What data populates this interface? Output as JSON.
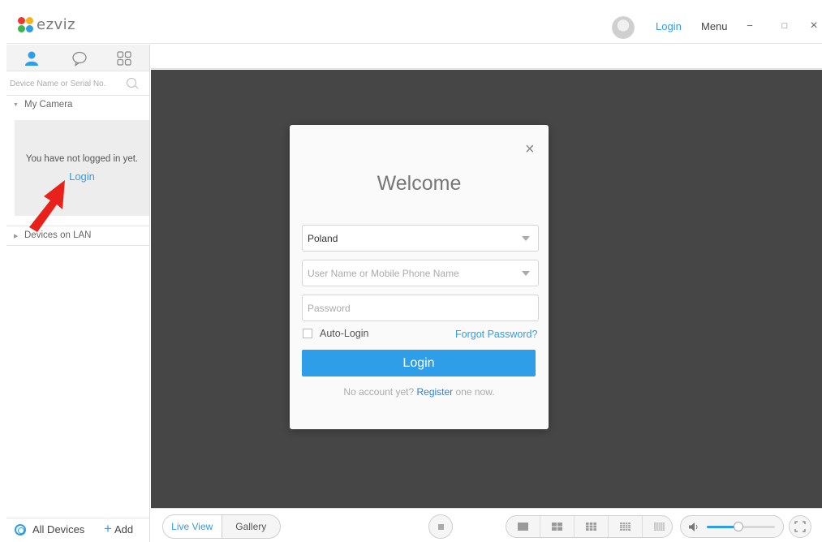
{
  "app": {
    "logo_text": "ezviz"
  },
  "titlebar": {
    "login_label": "Login",
    "menu_label": "Menu",
    "minimize_glyph": "−",
    "maximize_glyph": "□",
    "close_glyph": "×"
  },
  "sidebar": {
    "tabs": [
      "person-icon",
      "chat-bubble-icon",
      "grid-icon"
    ],
    "search": {
      "placeholder": "Device Name or Serial No."
    },
    "my_camera_label": "My Camera",
    "not_logged_message": "You have not logged in yet.",
    "not_logged_link": "Login",
    "devices_on_lan_label": "Devices on LAN",
    "all_devices_label": "All Devices",
    "add_label": "Add"
  },
  "bottombar": {
    "live_view_label": "Live View",
    "gallery_label": "Gallery",
    "volume_level": 0.46
  },
  "dialog": {
    "title": "Welcome",
    "close_glyph": "×",
    "country_value": "Poland",
    "username_placeholder": "User Name or Mobile Phone Name",
    "password_placeholder": "Password",
    "auto_login_label": "Auto-Login",
    "forgot_password_label": "Forgot Password?",
    "login_button_label": "Login",
    "no_account_text": "No account yet?",
    "register_label": "Register",
    "register_suffix": "one now."
  },
  "colors": {
    "accent": "#2f9ee8",
    "video_bg": "#464646",
    "annotation_arrow": "#e8211b"
  }
}
